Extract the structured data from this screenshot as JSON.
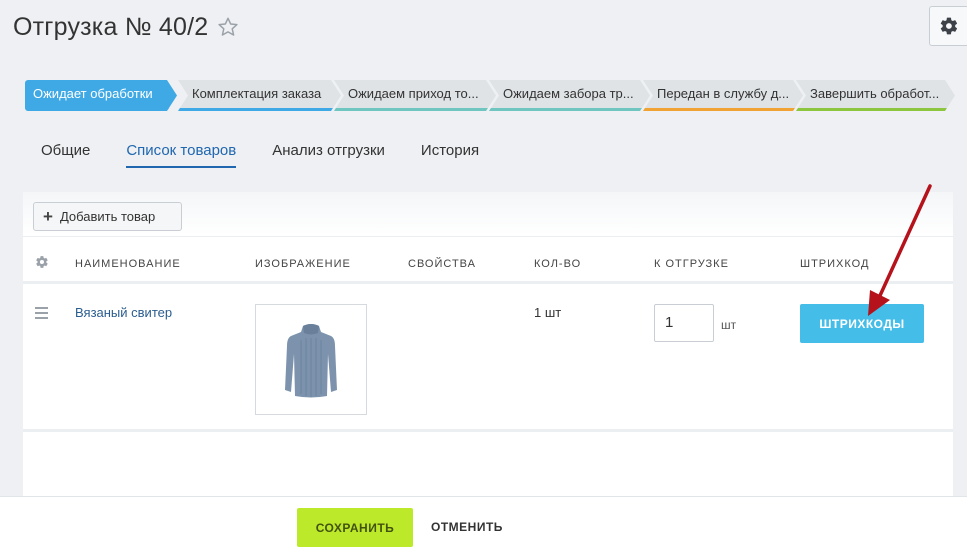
{
  "header": {
    "title": "Отгрузка № 40/2"
  },
  "stages": [
    {
      "label": "Ожидает обработки",
      "color": "#3fa9e6"
    },
    {
      "label": "Комплектация заказа",
      "color": "#3fa9e6"
    },
    {
      "label": "Ожидаем приход то...",
      "color": "#6fc6c0"
    },
    {
      "label": "Ожидаем забора тр...",
      "color": "#6fc6c0"
    },
    {
      "label": "Передан в службу д...",
      "color": "#f0a232"
    },
    {
      "label": "Завершить обработ...",
      "color": "#8cc63f"
    }
  ],
  "tabs": [
    {
      "label": "Общие",
      "active": false
    },
    {
      "label": "Список товаров",
      "active": true
    },
    {
      "label": "Анализ отгрузки",
      "active": false
    },
    {
      "label": "История",
      "active": false
    }
  ],
  "toolbar": {
    "add_label": "Добавить товар"
  },
  "table": {
    "columns": [
      "Наименование",
      "Изображение",
      "Свойства",
      "Кол-во",
      "К отгрузке",
      "Штрихкод"
    ],
    "rows": [
      {
        "name": "Вязаный свитер",
        "properties": "",
        "qty": "1 шт",
        "ship_value": "1",
        "ship_unit": "шт",
        "barcode_label": "ШТРИХКОДЫ"
      }
    ]
  },
  "footer": {
    "save_label": "СОХРАНИТЬ",
    "cancel_label": "ОТМЕНИТЬ"
  },
  "colors": {
    "accent": "#3fa9e6",
    "barcode_button": "#45bde9",
    "save_button": "#bcea2a",
    "link": "#2a5d8f",
    "annotation_arrow": "#b5121b"
  }
}
